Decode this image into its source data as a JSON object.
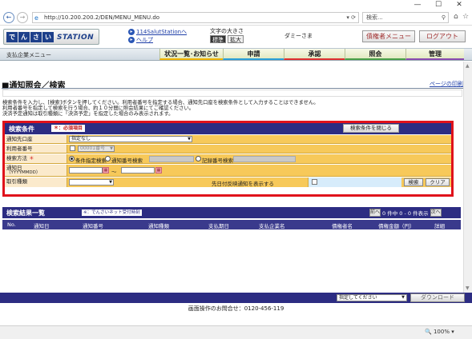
{
  "browser": {
    "url": "http://10.200.200.2/DEN/MENU_MENU.do",
    "search_placeholder": "検索...",
    "zoom": "100%"
  },
  "header": {
    "logo_kana": [
      "で",
      "ん",
      "さ",
      "い"
    ],
    "logo_station": "STATION",
    "link1": "114SalutStationへ",
    "link2": "ヘルプ",
    "fontsize_label": "文字の大きさ",
    "fontsize_std": "標準",
    "fontsize_big": "拡大",
    "user": "ダミーさま",
    "admin_menu": "債権者メニュー",
    "logout": "ログアウト"
  },
  "menubar": {
    "system": "支払企業メニュー",
    "tabs": [
      "状況一覧･お知らせ",
      "申請",
      "承認",
      "照会",
      "管理"
    ]
  },
  "page": {
    "title": "■通知照会／検索",
    "print_link": "ページの印刷",
    "instructions": [
      "検索条件を入力し、[検索]ボタンを押してください。利用者番号を指定する場合、通知先口座を検索条件として入力することはできません。",
      "利用者番号を指定して検索を行う場合、約１０分間に照会結果にてご確認ください。",
      "決済予定通知は取引種類に「決済予定」を指定した場合のみ表示されます。"
    ]
  },
  "search": {
    "title": "検索条件",
    "required_badge": "＊：必須項目",
    "close_button": "検索条件を閉じる",
    "account_label": "通知先口座",
    "account_value": "指定なし",
    "user_label": "利用者番号",
    "user_select": "00001番号",
    "method_label": "検索方法",
    "method_required": "＊",
    "method_options": [
      "条件指定検索",
      "通知番号検索",
      "記録番号検索"
    ],
    "date_label": "通知日",
    "date_format": "（YYYYMMDD）",
    "date_sep": "〜",
    "cal_glyph": "▦",
    "type_label": "取引種類",
    "future_label": "先日付反映通知を表示する",
    "search_button": "検索",
    "clear_button": "クリア"
  },
  "results": {
    "title": "検索結果一覧",
    "note": "※：でんさいネット受付時刻",
    "pager_prev": "前へ",
    "pager_text": "0 件中 0 - 0 件表示",
    "pager_next": "次へ",
    "columns": [
      "No.",
      "通知日",
      "通知番号",
      "通知種類",
      "支払期日",
      "支払企業名",
      "債権者名",
      "債権金額（円）",
      "詳細"
    ],
    "download_select": "指定してください",
    "download_button": "ダウンロード",
    "contact": "画面操作のお問合せ：0120-456-119"
  }
}
